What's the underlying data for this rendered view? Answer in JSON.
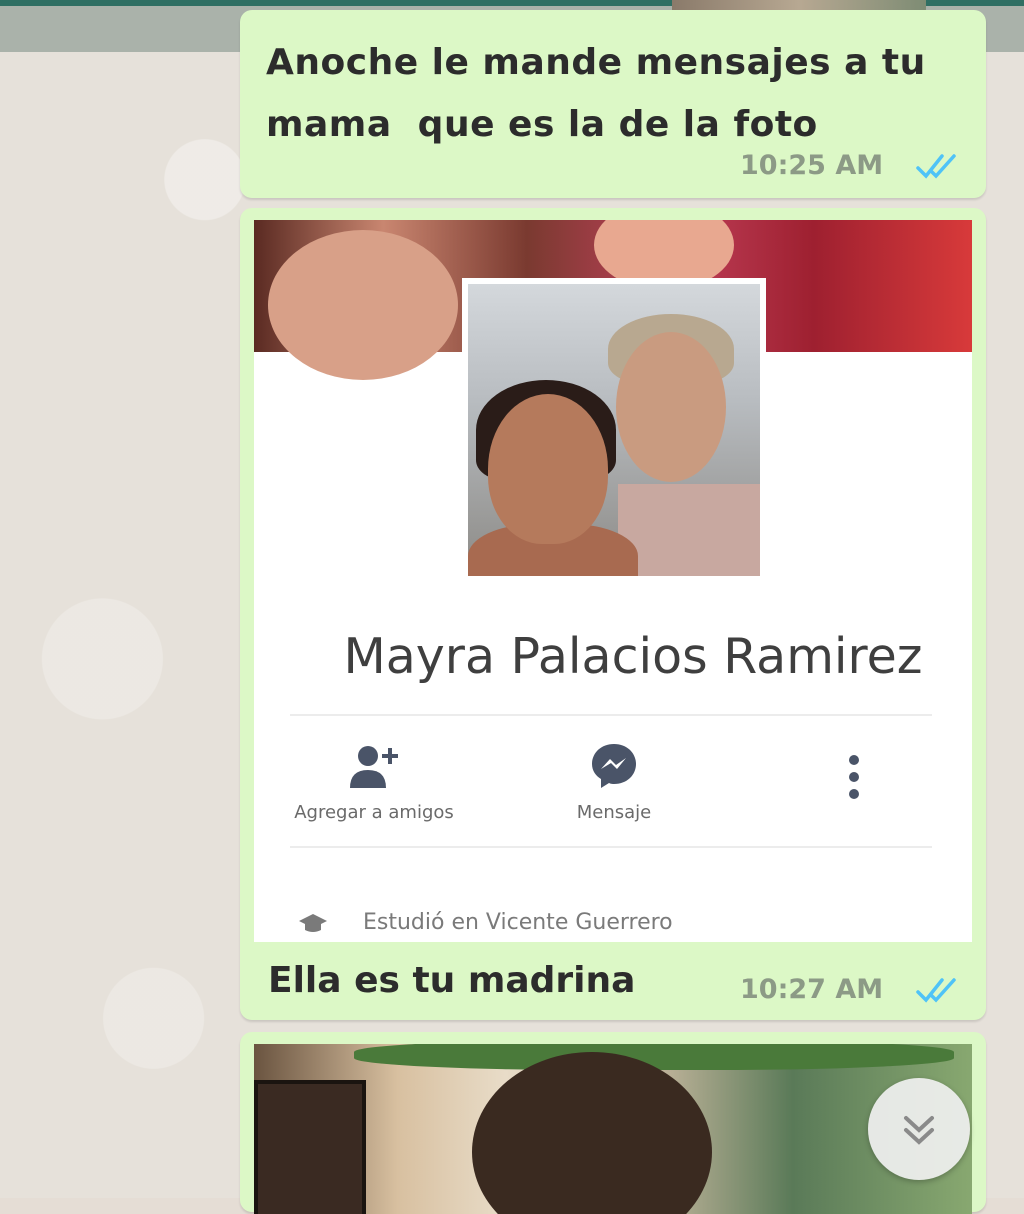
{
  "messages": [
    {
      "text_line1": "Anoche le mande mensajes a tu",
      "text_line2": "mama  que es la de la foto",
      "time": "10:25 AM",
      "status": "read"
    },
    {
      "profile": {
        "name": "Mayra Palacios Ramirez",
        "actions": [
          {
            "label": "Agregar a amigos",
            "icon": "add-friend-icon"
          },
          {
            "label": "Mensaje",
            "icon": "messenger-icon"
          },
          {
            "label": "",
            "icon": "more-vertical-icon"
          }
        ],
        "info": "Estudió en Vicente Guerrero"
      },
      "text": "Ella es tu madrina",
      "time": "10:27 AM",
      "status": "read"
    }
  ],
  "scroll_button": {
    "icon": "double-chevron-down-icon"
  },
  "colors": {
    "bubble": "#dcf8c6",
    "read_ticks": "#4fc3f7",
    "time": "#8c9a86"
  }
}
